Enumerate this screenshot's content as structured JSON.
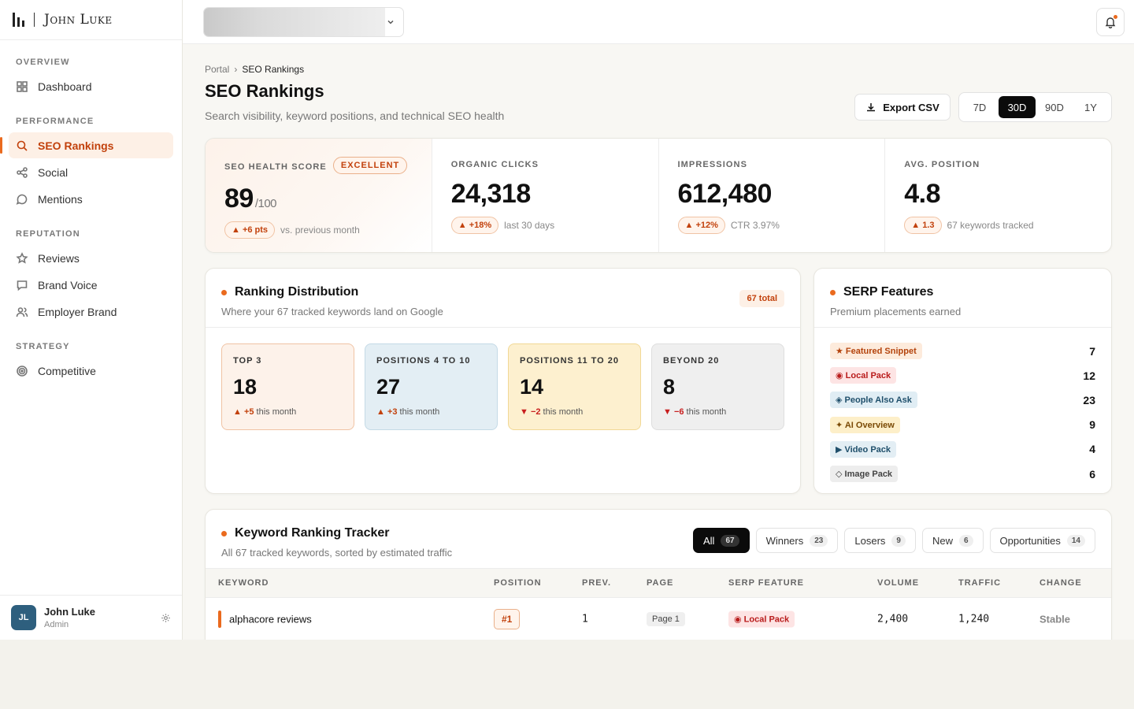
{
  "brand": {
    "name": "John Luke"
  },
  "sidebar": {
    "sections": [
      {
        "title": "OVERVIEW",
        "items": [
          {
            "label": "Dashboard",
            "icon": "grid-icon"
          }
        ]
      },
      {
        "title": "PERFORMANCE",
        "items": [
          {
            "label": "SEO Rankings",
            "icon": "search-icon",
            "active": true
          },
          {
            "label": "Social",
            "icon": "share-icon"
          },
          {
            "label": "Mentions",
            "icon": "chat-icon"
          }
        ]
      },
      {
        "title": "REPUTATION",
        "items": [
          {
            "label": "Reviews",
            "icon": "star-icon"
          },
          {
            "label": "Brand Voice",
            "icon": "message-icon"
          },
          {
            "label": "Employer Brand",
            "icon": "users-icon"
          }
        ]
      },
      {
        "title": "STRATEGY",
        "items": [
          {
            "label": "Competitive",
            "icon": "target-icon"
          }
        ]
      }
    ],
    "user": {
      "initials": "JL",
      "name": "John Luke",
      "role": "Admin"
    }
  },
  "breadcrumb": {
    "root": "Portal",
    "current": "SEO Rankings"
  },
  "page": {
    "title": "SEO Rankings",
    "subtitle": "Search visibility, keyword positions, and technical SEO health"
  },
  "toolbar": {
    "export_label": "Export CSV",
    "ranges": [
      "7D",
      "30D",
      "90D",
      "1Y"
    ],
    "active_range": "30D"
  },
  "kpis": {
    "health": {
      "label": "SEO HEALTH SCORE",
      "badge": "EXCELLENT",
      "value": "89",
      "suffix": "/100",
      "delta": "▲ +6 pts",
      "note": "vs. previous month"
    },
    "clicks": {
      "label": "ORGANIC CLICKS",
      "value": "24,318",
      "delta": "▲ +18%",
      "note": "last 30 days"
    },
    "impressions": {
      "label": "IMPRESSIONS",
      "value": "612,480",
      "delta": "▲ +12%",
      "note": "CTR 3.97%"
    },
    "position": {
      "label": "AVG. POSITION",
      "value": "4.8",
      "delta": "▲ 1.3",
      "note": "67 keywords tracked"
    }
  },
  "distribution": {
    "title": "Ranking Distribution",
    "subtitle": "Where your 67 tracked keywords land on Google",
    "total": "67 total",
    "buckets": [
      {
        "label": "TOP 3",
        "value": "18",
        "delta": "▲ +5",
        "note": " this month",
        "dir": "up",
        "bg": "#fdf2ea",
        "border": "#f0c3a4"
      },
      {
        "label": "POSITIONS 4 TO 10",
        "value": "27",
        "delta": "▲ +3",
        "note": " this month",
        "dir": "up",
        "bg": "#e3eef4",
        "border": "#c4dae6"
      },
      {
        "label": "POSITIONS 11 TO 20",
        "value": "14",
        "delta": "▼ −2",
        "note": " this month",
        "dir": "dn",
        "bg": "#fdf0cf",
        "border": "#f1d895"
      },
      {
        "label": "BEYOND 20",
        "value": "8",
        "delta": "▼ −6",
        "note": " this month",
        "dir": "dn",
        "bg": "#efefef",
        "border": "#dedede"
      }
    ]
  },
  "serp": {
    "title": "SERP Features",
    "subtitle": "Premium placements earned",
    "items": [
      {
        "label": "★ Featured Snippet",
        "count": "7",
        "bg": "#fdebdc",
        "fg": "#b4430c"
      },
      {
        "label": "◉ Local Pack",
        "count": "12",
        "bg": "#fde4e4",
        "fg": "#b91c1c"
      },
      {
        "label": "◈ People Also Ask",
        "count": "23",
        "bg": "#e0edf4",
        "fg": "#1f4f6b"
      },
      {
        "label": "✦ AI Overview",
        "count": "9",
        "bg": "#fdefc9",
        "fg": "#7a4a05"
      },
      {
        "label": "▶ Video Pack",
        "count": "4",
        "bg": "#e3eef4",
        "fg": "#1f4f6b"
      },
      {
        "label": "◇ Image Pack",
        "count": "6",
        "bg": "#ededed",
        "fg": "#444444"
      }
    ]
  },
  "tracker": {
    "title": "Keyword Ranking Tracker",
    "subtitle": "All 67 tracked keywords, sorted by estimated traffic",
    "filters": [
      {
        "label": "All",
        "count": "67",
        "active": true
      },
      {
        "label": "Winners",
        "count": "23"
      },
      {
        "label": "Losers",
        "count": "9"
      },
      {
        "label": "New",
        "count": "6"
      },
      {
        "label": "Opportunities",
        "count": "14"
      }
    ],
    "columns": [
      "KEYWORD",
      "POSITION",
      "PREV.",
      "PAGE",
      "SERP FEATURE",
      "VOLUME",
      "TRAFFIC",
      "CHANGE"
    ],
    "rows": [
      {
        "keyword": "alphacore reviews",
        "position": "#1",
        "prev": "1",
        "page": "Page 1",
        "feature": "◉ Local Pack",
        "volume": "2,400",
        "traffic": "1,240",
        "change": "Stable"
      }
    ]
  }
}
